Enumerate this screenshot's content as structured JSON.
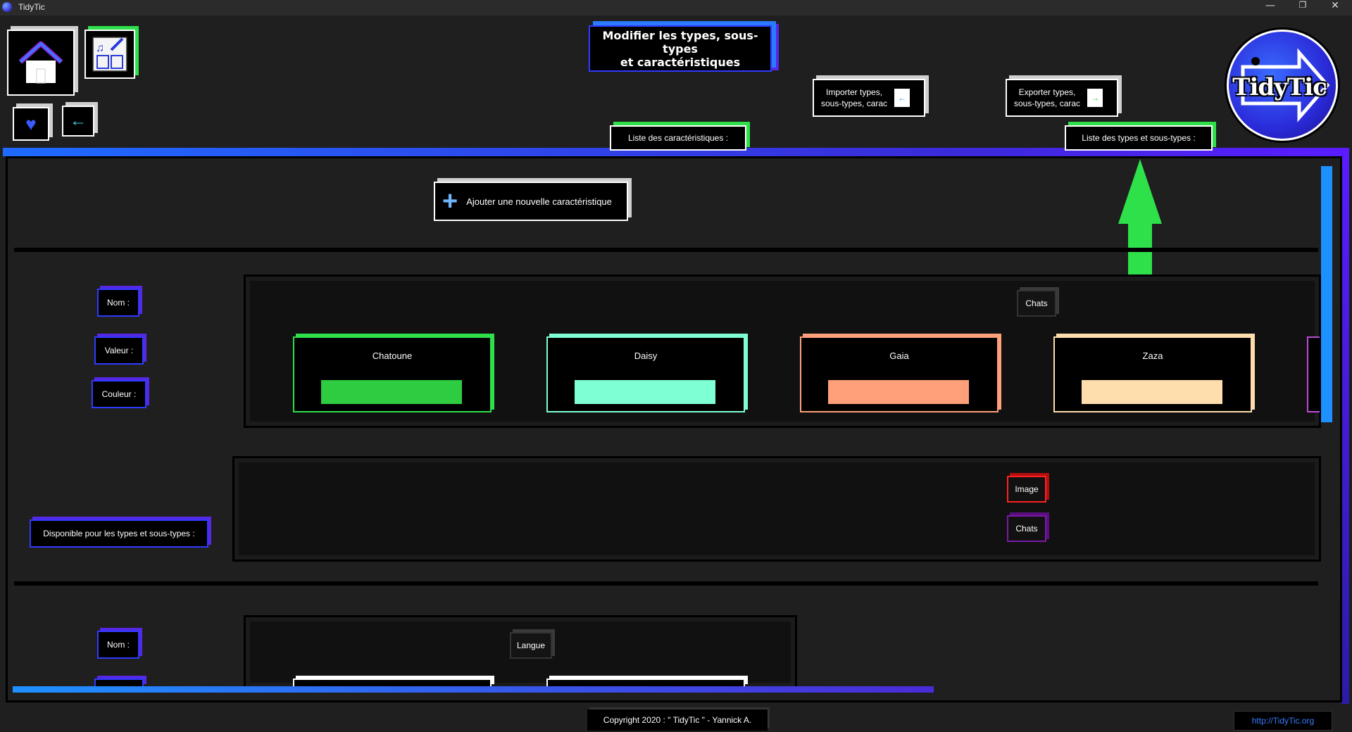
{
  "window": {
    "title": "TidyTic",
    "min": "—",
    "restore": "❐",
    "close": "✕"
  },
  "header": {
    "title_line1": "Modifier les types, sous-types",
    "title_line2": "et caractéristiques",
    "import_label_1": "Importer types,",
    "import_label_2": "sous-types, carac",
    "export_label_1": "Exporter types,",
    "export_label_2": "sous-types, carac",
    "tab_caracteristiques": "Liste des caractéristiques :",
    "tab_types": "Liste des types et sous-types :",
    "logo_text": "TidyTic"
  },
  "toolbar": {
    "add_label": "Ajouter une nouvelle caractéristique"
  },
  "labels": {
    "nom": "Nom :",
    "valeur": "Valeur :",
    "couleur": "Couleur :",
    "disponible": "Disponible pour les types et sous-types :"
  },
  "characteristic1": {
    "name": "Chats",
    "values": [
      {
        "name": "Chatoune",
        "color": "#2ecc40",
        "accent": "#2ee04a"
      },
      {
        "name": "Daisy",
        "color": "#7fffd4",
        "accent": "#7fffd4"
      },
      {
        "name": "Gaia",
        "color": "#ffa07a",
        "accent": "#ffa07a"
      },
      {
        "name": "Zaza",
        "color": "#ffdead",
        "accent": "#ffdead"
      }
    ],
    "available_types": [
      "Image",
      "Chats"
    ]
  },
  "characteristic2": {
    "name": "Langue"
  },
  "footer": {
    "copyright": "Copyright 2020 : \" TidyTic \" - Yannick A.",
    "link": "http://TidyTic.org"
  }
}
